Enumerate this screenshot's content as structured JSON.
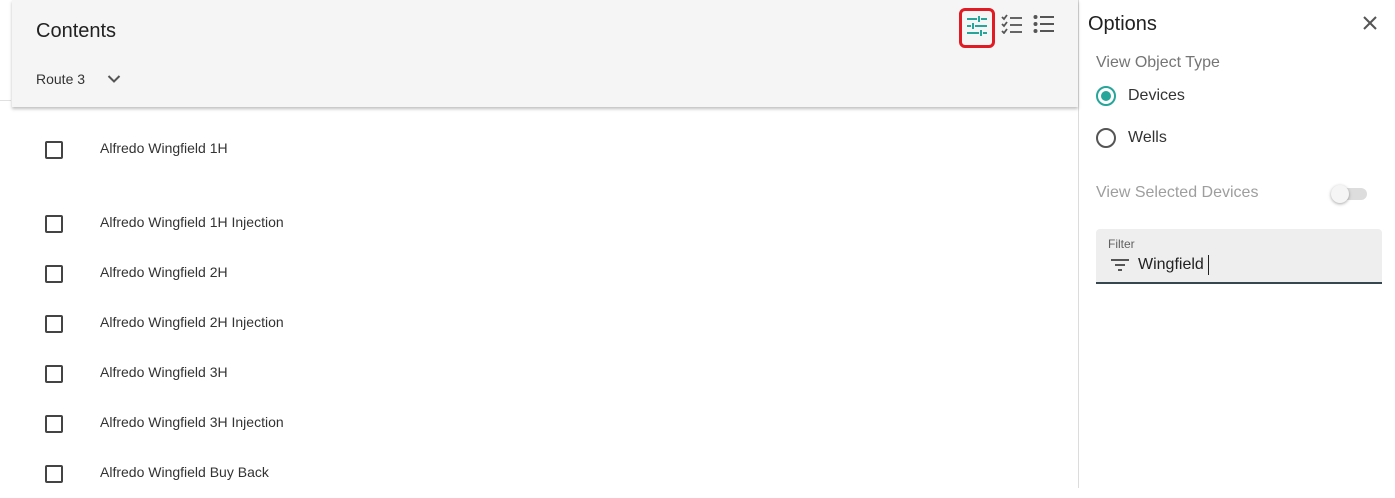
{
  "contents": {
    "title": "Contents",
    "route": "Route 3",
    "toolbar": {
      "options_icon": "tune-icon",
      "checklist_icon": "checklist-icon",
      "list_icon": "list-icon"
    },
    "items": [
      {
        "label": "Alfredo Wingfield 1H",
        "checked": false
      },
      {
        "label": "Alfredo Wingfield 1H Injection",
        "checked": false
      },
      {
        "label": "Alfredo Wingfield 2H",
        "checked": false
      },
      {
        "label": "Alfredo Wingfield 2H Injection",
        "checked": false
      },
      {
        "label": "Alfredo Wingfield 3H",
        "checked": false
      },
      {
        "label": "Alfredo Wingfield 3H Injection",
        "checked": false
      },
      {
        "label": "Alfredo Wingfield Buy Back",
        "checked": false
      }
    ]
  },
  "options": {
    "title": "Options",
    "view_object_type_label": "View Object Type",
    "object_types": [
      {
        "label": "Devices",
        "selected": true
      },
      {
        "label": "Wells",
        "selected": false
      }
    ],
    "view_selected_devices_label": "View Selected Devices",
    "view_selected_devices_on": false,
    "filter": {
      "label": "Filter",
      "value": "Wingfield"
    }
  },
  "colors": {
    "accent": "#26a69a",
    "highlight_border": "#e01b24",
    "header_bg": "#f5f5f5"
  }
}
